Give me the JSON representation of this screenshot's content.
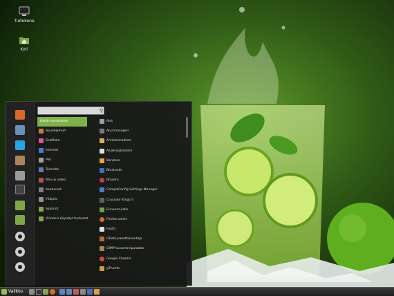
{
  "desktop": {
    "icons": [
      {
        "label": "Tietokone",
        "icon": "computer-icon"
      },
      {
        "label": "Koti",
        "icon": "home-folder-icon"
      }
    ]
  },
  "menu": {
    "search": {
      "placeholder": "",
      "icon": "search-icon"
    },
    "favorites": [
      {
        "icon": "firefox-icon",
        "color": "#d8692b"
      },
      {
        "icon": "software-manager-icon",
        "color": "#6a8fb8"
      },
      {
        "icon": "skype-icon",
        "color": "#2aa3e3"
      },
      {
        "icon": "gimp-icon",
        "color": "#a8865a"
      },
      {
        "icon": "settings-icon",
        "color": "#9a9a9a"
      },
      {
        "icon": "terminal-icon",
        "color": "#444444"
      },
      {
        "icon": "files-icon",
        "color": "#7ea84a"
      },
      {
        "icon": "folder-icon",
        "color": "#7ea84a"
      },
      {
        "icon": "lock-screen-icon",
        "color": "#cccccc"
      },
      {
        "icon": "logout-icon",
        "color": "#cccccc"
      },
      {
        "icon": "shutdown-icon",
        "color": "#cccccc"
      }
    ],
    "categories": [
      {
        "label": "Kaikki sovellukset",
        "selected": true,
        "color": "#7fb14b"
      },
      {
        "label": "Apuohjelmat",
        "color": "#c08040"
      },
      {
        "label": "Grafiikka",
        "color": "#d45a8c"
      },
      {
        "label": "Internet",
        "color": "#4a7fc0"
      },
      {
        "label": "Peli",
        "color": "#a0a0a0"
      },
      {
        "label": "Toimisto",
        "color": "#5a7fb0"
      },
      {
        "label": "Ääni & video",
        "color": "#b05050"
      },
      {
        "label": "Asetukset",
        "color": "#808080"
      },
      {
        "label": "Ylläpito",
        "color": "#909090"
      },
      {
        "label": "Sijainnit",
        "color": "#7ea84a"
      },
      {
        "label": "Viimeksi käytetyt tiedostot",
        "color": "#7ea84a"
      }
    ],
    "apps": [
      {
        "label": "Ajot",
        "color": "#9aa0a8"
      },
      {
        "label": "Ajurimanageri",
        "color": "#7a7a7a"
      },
      {
        "label": "Arkistonhallinta",
        "color": "#d4b060"
      },
      {
        "label": "Asiakirjakatselin",
        "color": "#e0e0e0"
      },
      {
        "label": "Banshee",
        "color": "#e8a040"
      },
      {
        "label": "Bluetooth",
        "color": "#3a70c8"
      },
      {
        "label": "Brasero",
        "color": "#c04040"
      },
      {
        "label": "CompizConfig Settings Manager",
        "color": "#4a80c0"
      },
      {
        "label": "Crusader Kings II",
        "color": "#606060"
      },
      {
        "label": "Ennenmuistio",
        "color": "#70a050"
      },
      {
        "label": "Firefox-selain",
        "color": "#d8692b"
      },
      {
        "label": "Fontti",
        "color": "#e0e0e0"
      },
      {
        "label": "GDebi-pakettiasentaja",
        "color": "#b07030"
      },
      {
        "label": "GIMP-kuvamanipulaatio",
        "color": "#a8865a"
      },
      {
        "label": "Google Chrome",
        "color": "#d04a3a"
      },
      {
        "label": "gThumb",
        "color": "#c8a040"
      }
    ]
  },
  "taskbar": {
    "menu_label": "Valikko",
    "launchers": [
      {
        "icon": "show-desktop-icon",
        "color": "#8a8a8a"
      },
      {
        "icon": "terminal-icon",
        "color": "#333333"
      },
      {
        "icon": "files-icon",
        "color": "#7ea84a"
      },
      {
        "icon": "firefox-icon",
        "color": "#d8692b"
      },
      {
        "icon": "window-icon",
        "color": "#5a88c0"
      },
      {
        "icon": "window-icon",
        "color": "#5a88c0"
      },
      {
        "icon": "window-icon",
        "color": "#c05a5a"
      },
      {
        "icon": "window-icon",
        "color": "#888888"
      },
      {
        "icon": "window-icon",
        "color": "#4a70b0"
      },
      {
        "icon": "window-icon",
        "color": "#d8a040"
      }
    ]
  }
}
